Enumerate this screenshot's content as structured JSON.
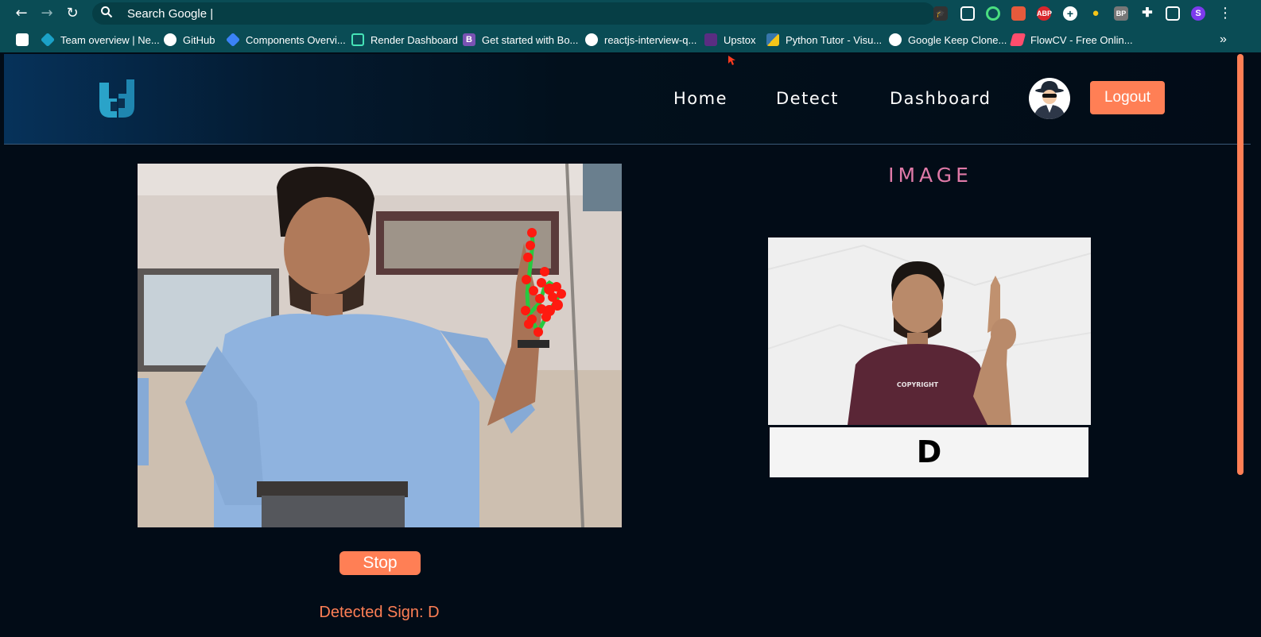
{
  "browser": {
    "omnibox_text": "Search Google |",
    "bookmarks": [
      {
        "label": "",
        "icon": "gmail-icon",
        "color": "#ea4335"
      },
      {
        "label": "Team overview | Ne...",
        "icon": "diamond-icon",
        "color": "#1ba1c7"
      },
      {
        "label": "GitHub",
        "icon": "github-icon",
        "color": "#ffffff"
      },
      {
        "label": "Components Overvi...",
        "icon": "components-icon",
        "color": "#3b82f6"
      },
      {
        "label": "Render Dashboard",
        "icon": "render-icon",
        "color": "#46e3b7"
      },
      {
        "label": "Get started with Bo...",
        "icon": "bootstrap-icon",
        "color": "#7952b3"
      },
      {
        "label": "reactjs-interview-q...",
        "icon": "github-icon",
        "color": "#ffffff"
      },
      {
        "label": "Upstox",
        "icon": "upstox-icon",
        "color": "#5a2d82"
      },
      {
        "label": "Python Tutor - Visu...",
        "icon": "python-icon",
        "color": "#f5c518"
      },
      {
        "label": "Google Keep Clone...",
        "icon": "globe-icon",
        "color": "#ffffff"
      },
      {
        "label": "FlowCV - Free Onlin...",
        "icon": "flowcv-icon",
        "color": "#ff4d6d"
      }
    ],
    "more_bookmarks": "»",
    "profile_initial": "S"
  },
  "header": {
    "nav": [
      "Home",
      "Detect",
      "Dashboard"
    ],
    "logout_label": "Logout"
  },
  "main": {
    "image_title": "IMAGE",
    "sign_letter": "D",
    "sign_shirt_text": "COPYRIGHT",
    "stop_label": "Stop",
    "detected_text": "Detected Sign: D"
  },
  "colors": {
    "accent": "#ff7f55",
    "title_pink": "#e07aa8",
    "page_bg": "#020c17",
    "chrome_bg": "#0a4c55"
  }
}
